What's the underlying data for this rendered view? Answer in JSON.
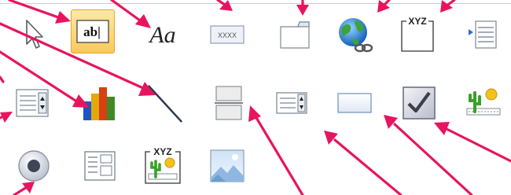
{
  "toolbox": {
    "selected_control": "Text Box",
    "label_control": {
      "glyph": "Aa"
    },
    "textbox_control": {
      "glyph": "ab|"
    },
    "formatted_text_control": {
      "glyph": "XXXX"
    },
    "option_group_control": {
      "glyph": "XYZ"
    },
    "bound_frame_control": {
      "glyph": "XYZ"
    }
  },
  "colors": {
    "annotation_arrow": "#e8145f",
    "selected_fill": "#f9c95c",
    "selected_border": "#e3a533"
  },
  "icons": [
    "select-pointer-icon",
    "text-box-icon",
    "label-icon",
    "formatted-text-icon",
    "tab-control-icon",
    "hyperlink-icon",
    "option-group-icon",
    "navigation-list-icon",
    "combo-box-icon",
    "chart-icon",
    "line-icon",
    "page-break-icon",
    "list-box-icon",
    "rectangle-icon",
    "check-box-icon",
    "unbound-object-frame-icon",
    "option-button-icon",
    "subform-icon",
    "bound-object-frame-icon",
    "image-icon"
  ]
}
